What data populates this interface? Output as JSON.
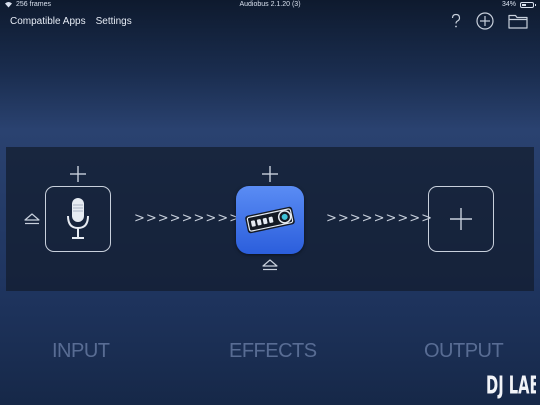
{
  "status": {
    "frames": "256 frames",
    "app_title": "Audiobus 2.1.20 (3)",
    "battery": "34%"
  },
  "nav": {
    "compatible_apps": "Compatible Apps",
    "settings": "Settings",
    "help_icon": "help-icon",
    "add_icon": "add-circle-icon",
    "folder_icon": "folder-icon"
  },
  "chain": {
    "input_icon": "microphone-icon",
    "effect_icon": "effect-app-icon",
    "output_icon": "plus-icon",
    "arrows": ">>>>>>>>>"
  },
  "labels": {
    "input": "INPUT",
    "effects": "EFFECTS",
    "output": "OUTPUT"
  },
  "watermark": {
    "text": "DJ LAB"
  },
  "colors": {
    "effect_tile": "#3a6ee8",
    "line": "#c8d0dc",
    "label": "#8ca0c8"
  }
}
